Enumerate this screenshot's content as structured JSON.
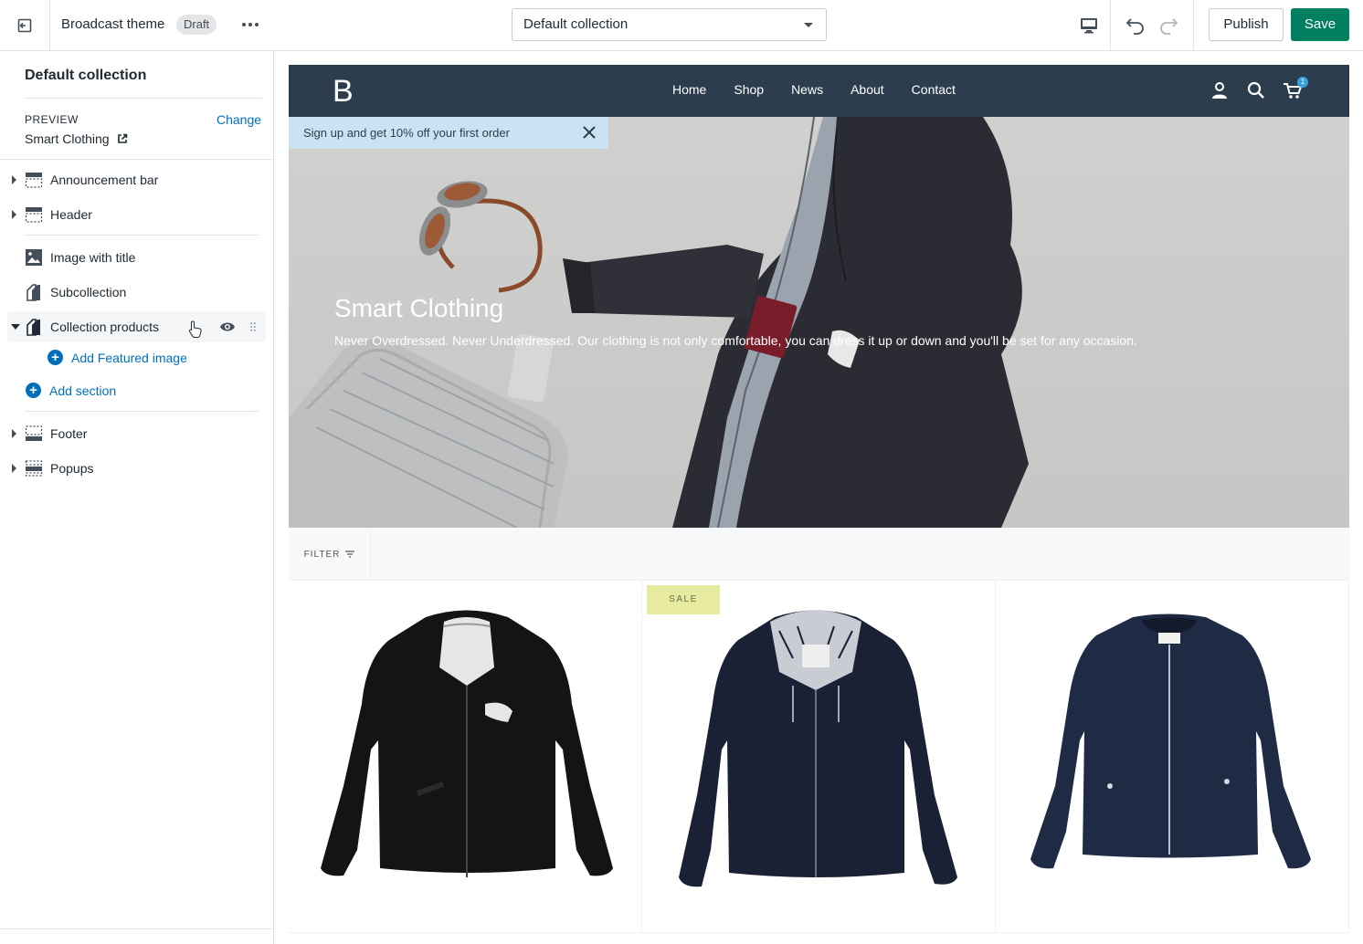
{
  "topbar": {
    "theme_name": "Broadcast theme",
    "draft_label": "Draft",
    "more_label": "•••",
    "template_select": "Default collection",
    "publish_label": "Publish",
    "save_label": "Save"
  },
  "sidebar": {
    "title": "Default collection",
    "preview_label": "PREVIEW",
    "change_label": "Change",
    "preview_value": "Smart Clothing",
    "items": [
      {
        "label": "Announcement bar",
        "icon": "section-icon"
      },
      {
        "label": "Header",
        "icon": "header-icon"
      },
      {
        "label": "Image with title",
        "icon": "image-icon"
      },
      {
        "label": "Subcollection",
        "icon": "collection-icon"
      },
      {
        "label": "Collection products",
        "icon": "collection-icon"
      },
      {
        "label": "Footer",
        "icon": "footer-icon"
      },
      {
        "label": "Popups",
        "icon": "section-icon"
      }
    ],
    "add_block_label": "Add Featured image",
    "add_section_label": "Add section"
  },
  "store": {
    "logo": "B",
    "nav": [
      "Home",
      "Shop",
      "News",
      "About",
      "Contact"
    ],
    "cart_count": "1",
    "announcement": "Sign up and get 10% off your first order",
    "hero_title": "Smart Clothing",
    "hero_subtitle": "Never Overdressed. Never Underdressed. Our clothing is not only comfortable, you can dress it up or down and you'll be set for any occasion.",
    "filter_label": "FILTER",
    "sale_label": "SALE"
  },
  "colors": {
    "primary_green": "#008060",
    "link_blue": "#006fbb",
    "store_header": "#2c3e4e",
    "announcement_bg": "#c9e3f2"
  }
}
